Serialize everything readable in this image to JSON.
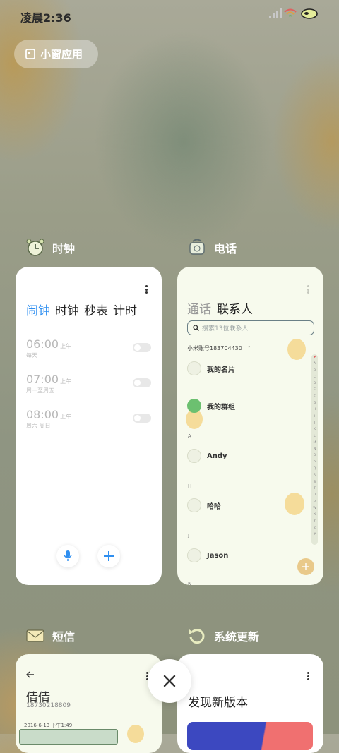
{
  "status": {
    "time": "凌晨2:36"
  },
  "floating_button": {
    "label": "小窗应用"
  },
  "apps": {
    "clock": {
      "name": "时钟"
    },
    "phone": {
      "name": "电话"
    },
    "sms": {
      "name": "短信"
    },
    "update": {
      "name": "系统更新"
    }
  },
  "clock_card": {
    "tabs": [
      "闹钟",
      "时钟",
      "秒表",
      "计时"
    ],
    "alarms": [
      {
        "time": "06:00",
        "ampm": "上午",
        "repeat": "每天"
      },
      {
        "time": "07:00",
        "ampm": "上午",
        "repeat": "周一至周五"
      },
      {
        "time": "08:00",
        "ampm": "上午",
        "repeat": "周六 周日"
      }
    ]
  },
  "phone_card": {
    "tabs": [
      "通话",
      "联系人"
    ],
    "search_placeholder": "搜索13位联系人",
    "account": "小米账号183704430",
    "my_card": "我的名片",
    "my_groups": "我的群组",
    "sections": [
      {
        "letter": "A",
        "name": "Andy"
      },
      {
        "letter": "H",
        "name": "哈哈"
      },
      {
        "letter": "J",
        "name": "Jason"
      }
    ],
    "next_letter": "N",
    "index_letters": [
      "♥",
      "A",
      "B",
      "C",
      "D",
      "E",
      "F",
      "G",
      "H",
      "I",
      "J",
      "K",
      "L",
      "M",
      "N",
      "O",
      "P",
      "Q",
      "R",
      "S",
      "T",
      "U",
      "V",
      "W",
      "X",
      "Y",
      "Z",
      "#"
    ]
  },
  "sms_card": {
    "contact": "倩倩",
    "number": "18730218809",
    "date": "2016-6-13 下午1:49"
  },
  "update_card": {
    "title": "发现新版本"
  },
  "colors": {
    "accent_blue": "#2f8ff0",
    "fab_orange": "#e9c98a"
  }
}
